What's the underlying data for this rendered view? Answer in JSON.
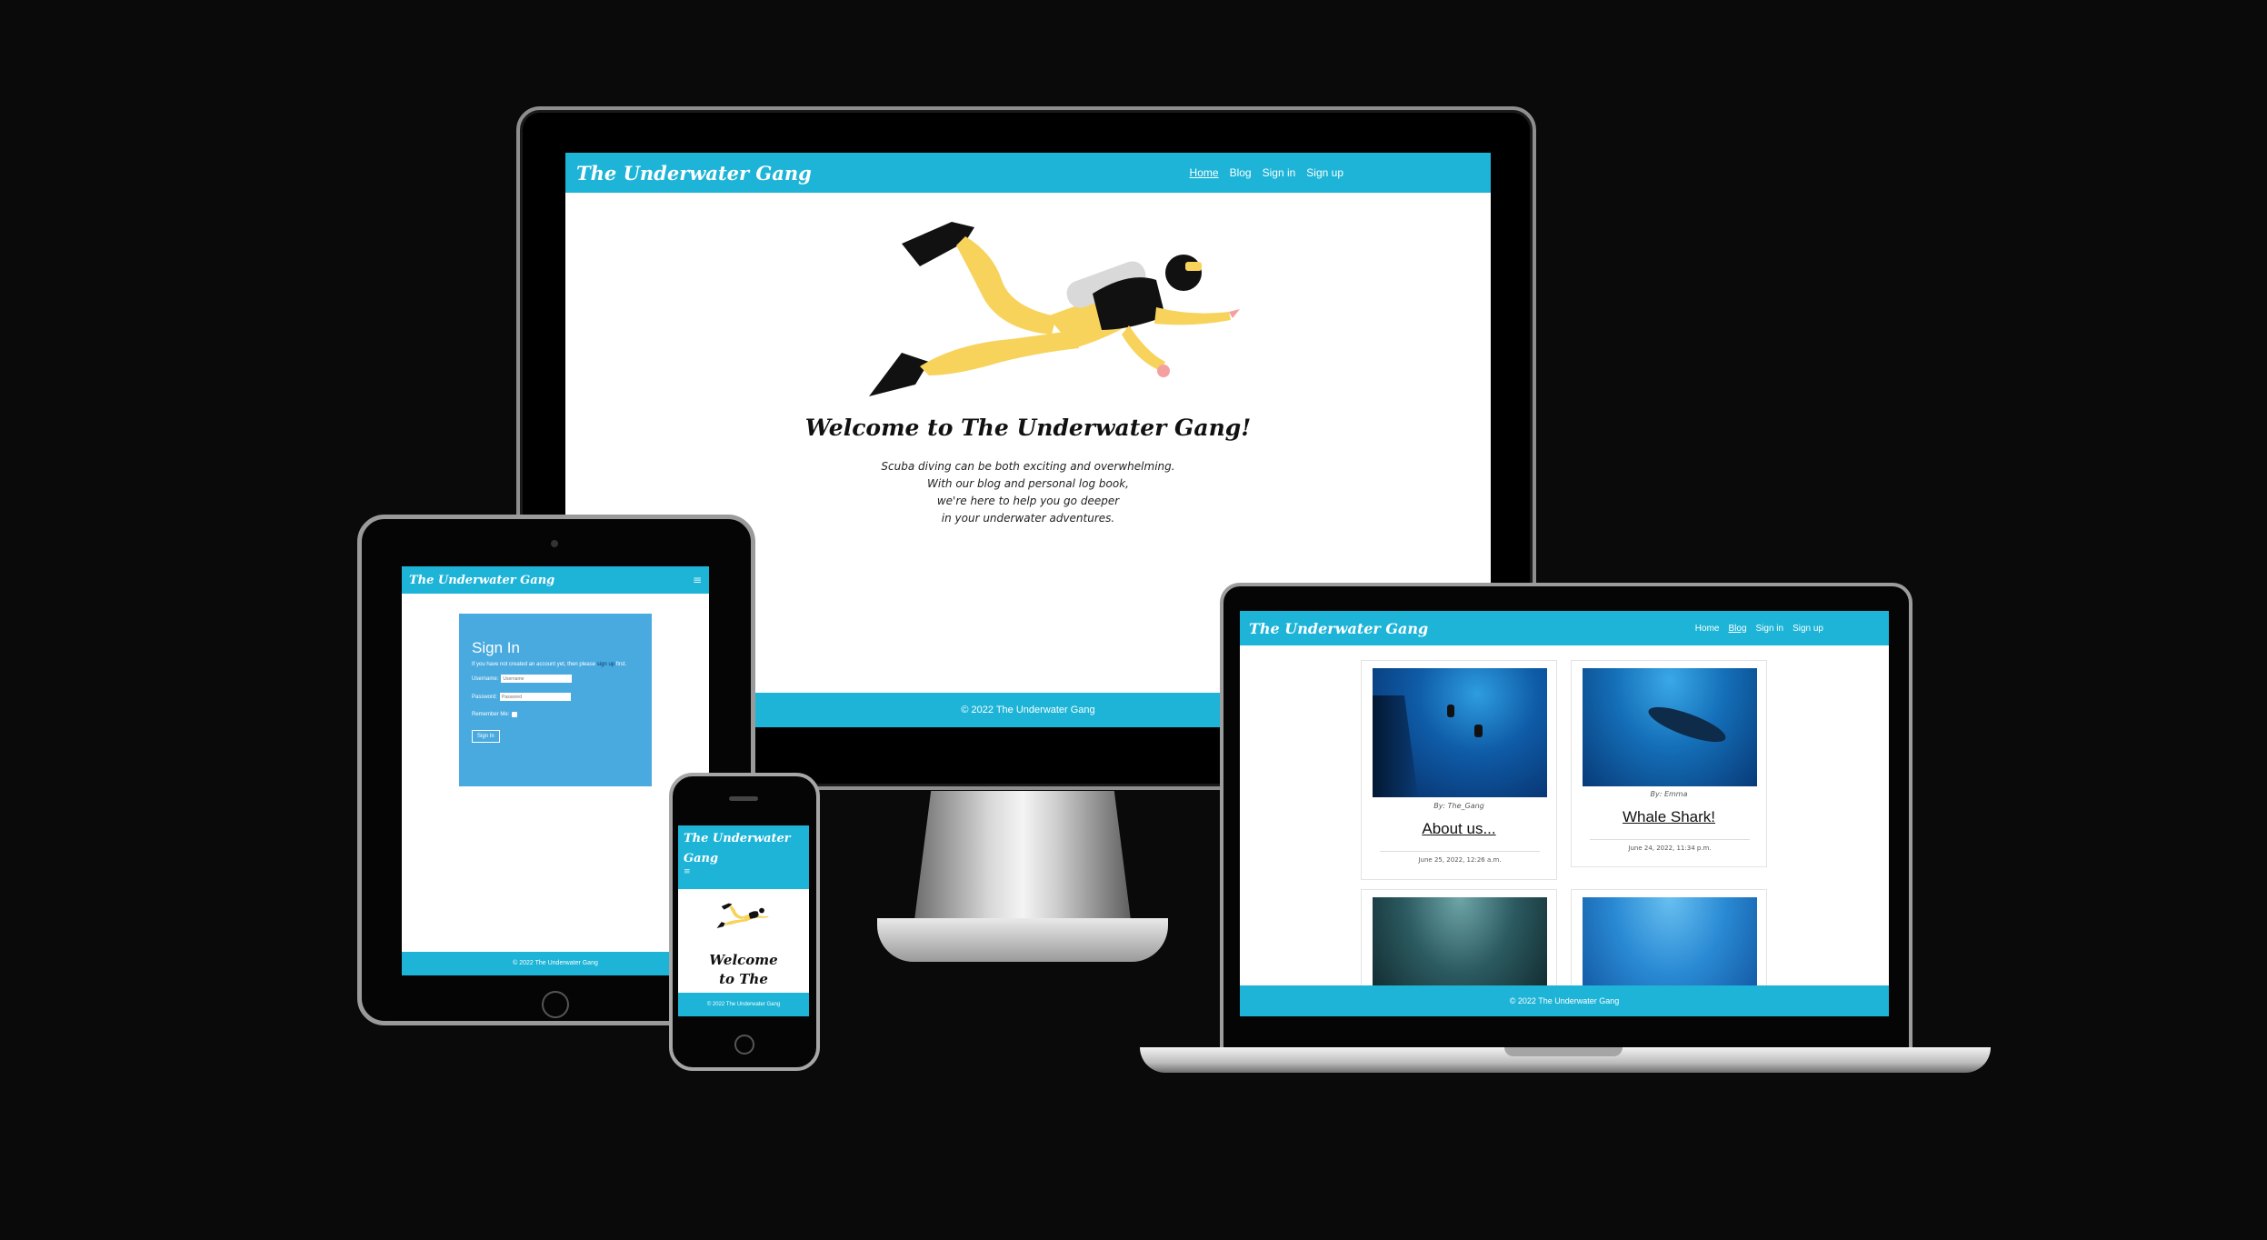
{
  "site": {
    "brand": "The Underwater Gang",
    "nav": [
      "Home",
      "Blog",
      "Sign in",
      "Sign up"
    ],
    "footer": "© 2022 The Underwater Gang",
    "menu_icon": "≡",
    "hamburger": "hamburger-icon"
  },
  "home": {
    "heading": "Welcome to The Underwater Gang!",
    "intro": [
      "Scuba diving can be both exciting and overwhelming.",
      "With our blog and personal log book,",
      "we're here to help you go deeper",
      "in your underwater adventures."
    ]
  },
  "phone": {
    "brand_line1": "The Underwater",
    "brand_line2": "Gang",
    "heading_line1": "Welcome",
    "heading_line2": "to The"
  },
  "signin": {
    "title": "Sign In",
    "note_prefix": "If you have not created an account yet, then please",
    "note_link": "sign up",
    "note_suffix": "first.",
    "username_label": "Username:",
    "username_placeholder": "Username",
    "password_label": "Password:",
    "password_placeholder": "Password",
    "remember_label": "Remember Me:",
    "button": "Sign In"
  },
  "blog": {
    "posts": [
      {
        "author": "By: The_Gang",
        "title": "About us...",
        "date": "June 25, 2022, 12:26 a.m."
      },
      {
        "author": "By: Emma",
        "title": "Whale Shark!",
        "date": "June 24, 2022, 11:34 p.m."
      }
    ]
  },
  "colors": {
    "primary": "#1db4d7",
    "signin_panel": "#49aae0",
    "diver_suit": "#f7d35c",
    "background": "#0a0a0a"
  }
}
